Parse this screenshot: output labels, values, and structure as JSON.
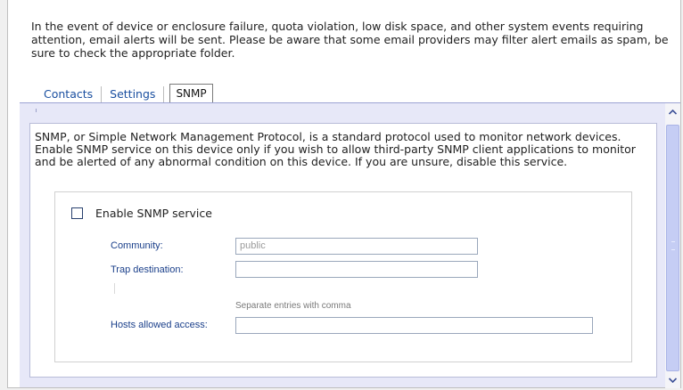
{
  "intro_text": "In the event of device or enclosure failure, quota violation, low disk space, and other system events requiring attention, email alerts will be sent. Please be aware that some email providers may filter alert emails as spam, be sure to check the appropriate folder.",
  "tabs": [
    {
      "label": "Contacts",
      "active": false
    },
    {
      "label": "Settings",
      "active": false
    },
    {
      "label": "SNMP",
      "active": true
    }
  ],
  "snmp": {
    "description": "SNMP, or Simple Network Management Protocol, is a standard protocol used to monitor network devices. Enable SNMP service on this device only if you wish to allow third-party SNMP client applications to monitor and be alerted of any abnormal condition on this device. If you are unsure, disable this service.",
    "enable_label": "Enable SNMP service",
    "enable_checked": false,
    "community_label": "Community:",
    "community_value": "public",
    "trap_label": "Trap destination:",
    "trap_value": "",
    "hint": "Separate entries with comma",
    "hosts_label": "Hosts allowed access:",
    "hosts_value": ""
  },
  "scrollbar": {
    "up_icon": "chevron-up-icon",
    "down_icon": "chevron-down-icon"
  },
  "colors": {
    "panel_bg": "#e7e8f8",
    "label_blue": "#1a3f8a",
    "tab_link": "#1a4fa0"
  }
}
